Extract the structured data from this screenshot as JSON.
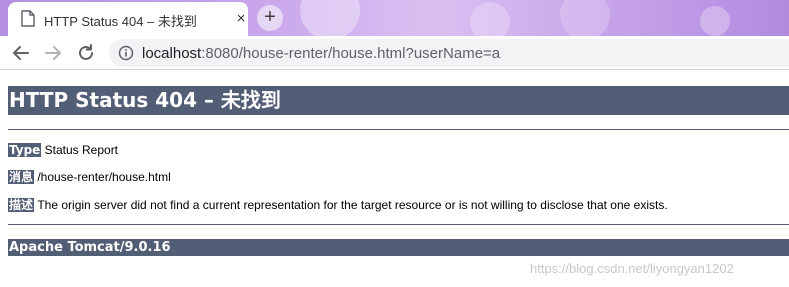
{
  "tab": {
    "title": "HTTP Status 404 – 未找到",
    "close_glyph": "×"
  },
  "new_tab_glyph": "+",
  "toolbar": {
    "url_host": "localhost",
    "url_rest": ":8080/house-renter/house.html?userName=a"
  },
  "page": {
    "title": "HTTP Status 404 – 未找到",
    "rows": [
      {
        "label": "Type",
        "value": " Status Report"
      },
      {
        "label": "消息",
        "value": " /house-renter/house.html"
      },
      {
        "label": "描述",
        "value": " The origin server did not find a current representation for the target resource or is not willing to disclose that one exists."
      }
    ],
    "footer": "Apache Tomcat/9.0.16"
  },
  "watermark": "https://blog.csdn.net/liyongyan1202",
  "colors": {
    "tomcat_header": "#525d76",
    "tabstrip": "#c7a3ea"
  },
  "icons": [
    "document-icon",
    "close-icon",
    "plus-icon",
    "back-arrow-icon",
    "forward-arrow-icon",
    "reload-icon",
    "info-icon"
  ]
}
